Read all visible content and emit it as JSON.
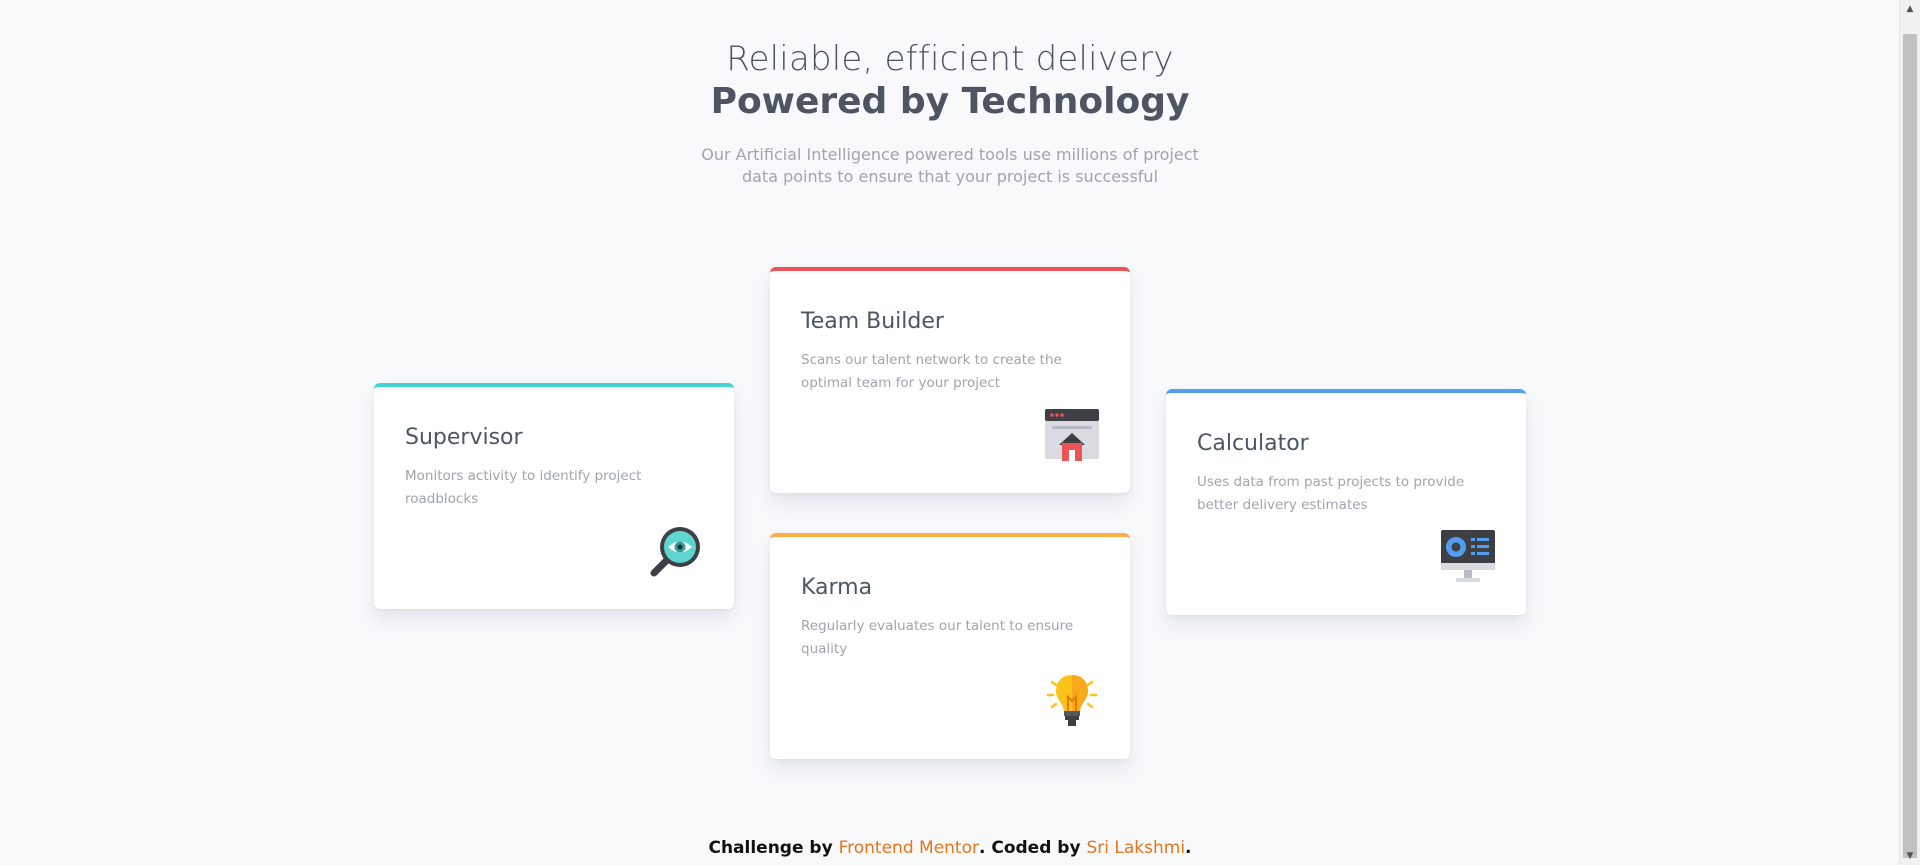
{
  "header": {
    "title_light": "Reliable, efficient delivery",
    "title_bold": "Powered by Technology",
    "description": "Our Artificial Intelligence powered tools use millions of project data points to ensure that your project is successful"
  },
  "cards": {
    "supervisor": {
      "title": "Supervisor",
      "text": "Monitors activity to identify project roadblocks",
      "accent": "#44d3d2",
      "icon": "magnifier-eye-icon"
    },
    "team_builder": {
      "title": "Team Builder",
      "text": "Scans our talent network to create the optimal team for your project",
      "accent": "#ea5454",
      "icon": "team-builder-icon"
    },
    "karma": {
      "title": "Karma",
      "text": "Regularly evaluates our talent to ensure quality",
      "accent": "#fcae4a",
      "icon": "lightbulb-icon"
    },
    "calculator": {
      "title": "Calculator",
      "text": "Uses data from past projects to provide better delivery estimates",
      "accent": "#549ef2",
      "icon": "monitor-chart-icon"
    }
  },
  "footer": {
    "prefix": "Challenge by ",
    "mentor_link": "Frontend Mentor",
    "middle": ". Coded by ",
    "author_link": "Sri Lakshmi",
    "suffix": "."
  }
}
